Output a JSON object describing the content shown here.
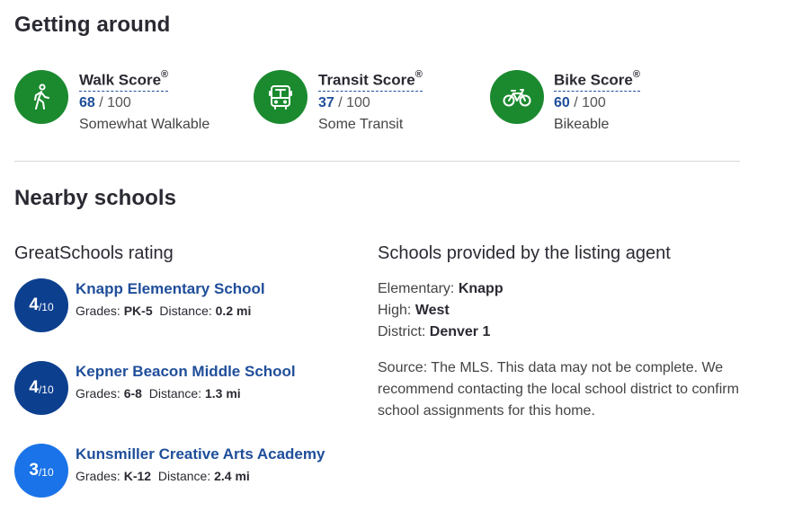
{
  "getting_around": {
    "title": "Getting around",
    "scores": [
      {
        "label": "Walk Score",
        "reg": "®",
        "value": "68",
        "out_of": " / 100",
        "desc": "Somewhat Walkable",
        "icon": "walk-icon"
      },
      {
        "label": "Transit Score",
        "reg": "®",
        "value": "37",
        "out_of": " / 100",
        "desc": "Some Transit",
        "icon": "bus-icon"
      },
      {
        "label": "Bike Score",
        "reg": "®",
        "value": "60",
        "out_of": " / 100",
        "desc": "Bikeable",
        "icon": "bike-icon"
      }
    ]
  },
  "schools": {
    "title": "Nearby schools",
    "greatschools_heading": "GreatSchools rating",
    "grades_label": "Grades:",
    "distance_label": "Distance:",
    "list": [
      {
        "rating": "4",
        "scale": "/10",
        "name": "Knapp Elementary School",
        "grades": "PK-5",
        "distance": "0.2 mi",
        "color": "#0d3f8f"
      },
      {
        "rating": "4",
        "scale": "/10",
        "name": "Kepner Beacon Middle School",
        "grades": "6-8",
        "distance": "1.3 mi",
        "color": "#0d3f8f"
      },
      {
        "rating": "3",
        "scale": "/10",
        "name": "Kunsmiller Creative Arts Academy",
        "grades": "K-12",
        "distance": "2.4 mi",
        "color": "#1a73e8"
      }
    ],
    "agent": {
      "heading": "Schools provided by the listing agent",
      "elementary_label": "Elementary:",
      "elementary": "Knapp",
      "high_label": "High:",
      "high": "West",
      "district_label": "District:",
      "district": "Denver 1",
      "source": "Source: The MLS. This data may not be complete. We recommend contacting the local school district to confirm school assignments for this home."
    }
  },
  "colors": {
    "score_green": "#1b8a2f",
    "link_blue": "#1f4e9a"
  }
}
